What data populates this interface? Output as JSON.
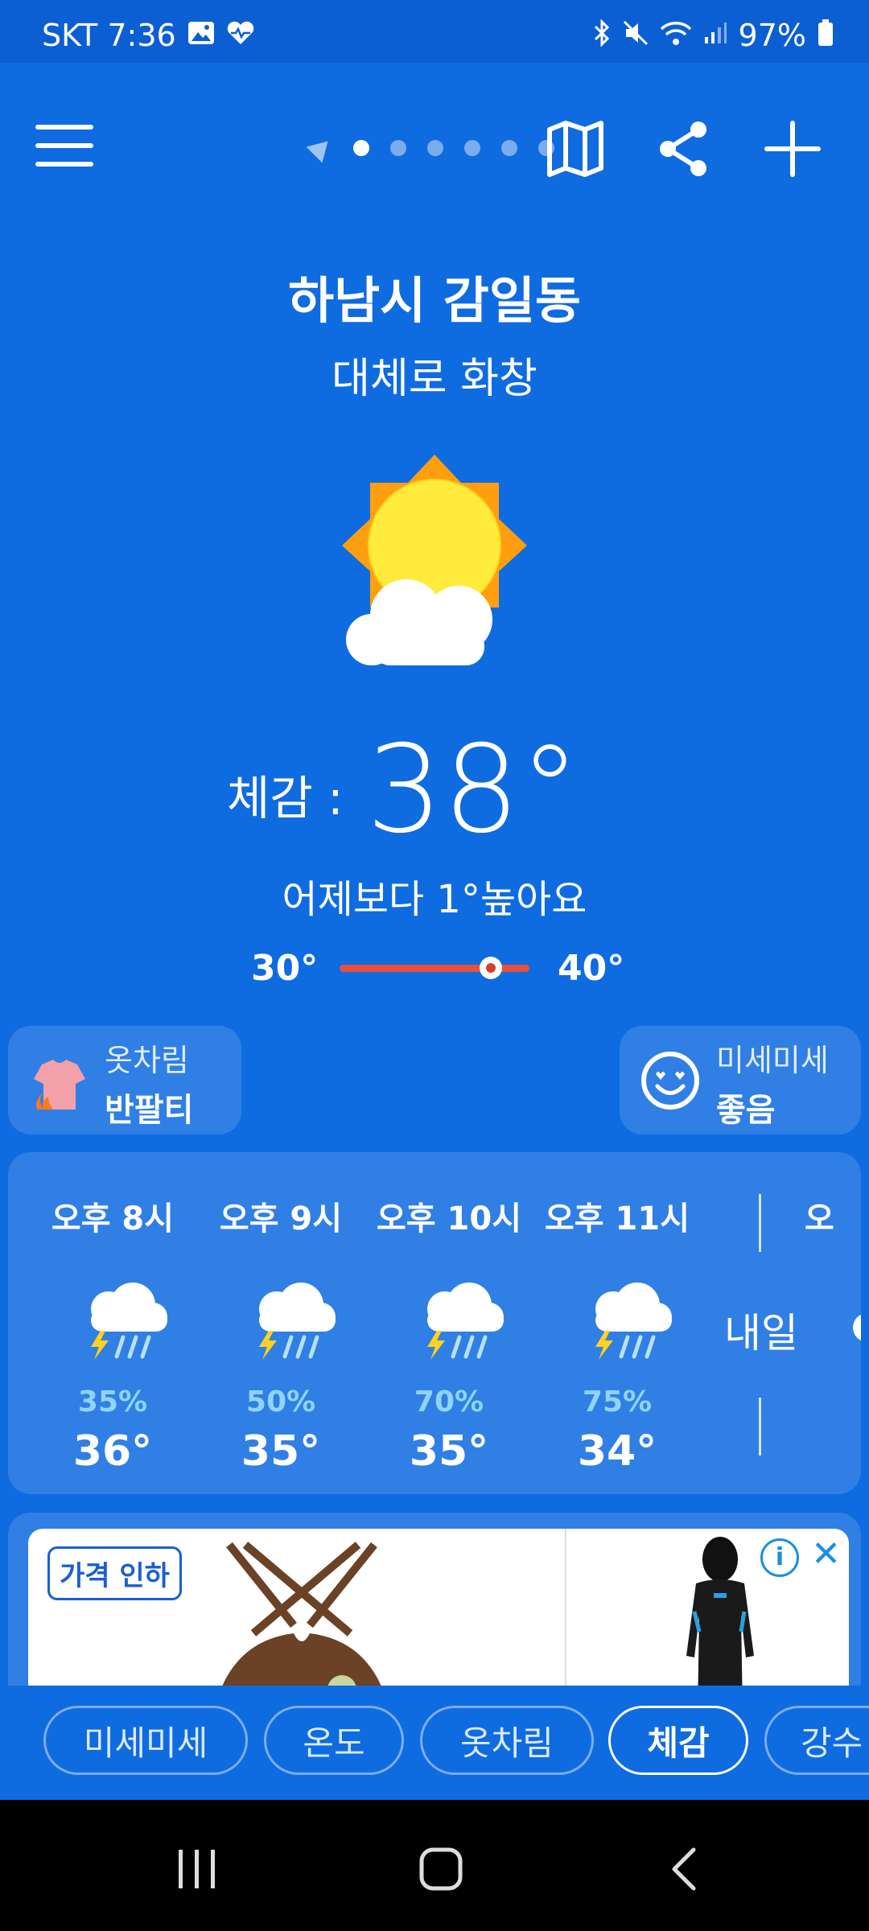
{
  "status_bar": {
    "carrier_time": "SKT 7:36",
    "battery": "97%"
  },
  "top_bar": {
    "page_count": 6,
    "active_page": 0
  },
  "location": "하남시 감일동",
  "condition": "대체로 화창",
  "feels_like": {
    "label": "체감 :",
    "value": "38°"
  },
  "compare_text": "어제보다 1°높아요",
  "range": {
    "low": "30°",
    "high": "40°",
    "current_fraction": 0.72
  },
  "outfit_card": {
    "title": "옷차림",
    "value": "반팔티"
  },
  "dust_card": {
    "title": "미세미세",
    "value": "좋음"
  },
  "hourly": [
    {
      "time": "오후 8시",
      "pop": "35%",
      "temp": "36°"
    },
    {
      "time": "오후 9시",
      "pop": "50%",
      "temp": "35°"
    },
    {
      "time": "오후 10시",
      "pop": "70%",
      "temp": "35°"
    },
    {
      "time": "오후 11시",
      "pop": "75%",
      "temp": "34°"
    }
  ],
  "hourly_next_label_partial": "오",
  "tomorrow_label": "내일",
  "ad": {
    "tag": "가격 인하"
  },
  "bottom_tabs": [
    {
      "label": "미세미세",
      "active": false
    },
    {
      "label": "온도",
      "active": false
    },
    {
      "label": "옷차림",
      "active": false
    },
    {
      "label": "체감",
      "active": true
    },
    {
      "label": "강수",
      "active": false
    }
  ]
}
